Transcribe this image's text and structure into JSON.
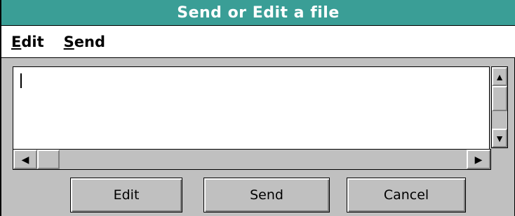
{
  "window": {
    "title": "Send or Edit a file"
  },
  "menu": {
    "items": [
      {
        "accel": "E",
        "rest": "dit"
      },
      {
        "accel": "S",
        "rest": "end"
      }
    ]
  },
  "editor": {
    "value": ""
  },
  "scrollbars": {
    "up_icon": "up-arrow-icon",
    "down_icon": "down-arrow-icon",
    "left_icon": "left-arrow-icon",
    "right_icon": "right-arrow-icon",
    "arrows": {
      "up": "▲",
      "down": "▼",
      "left": "◀",
      "right": "▶"
    }
  },
  "buttons": {
    "edit_label": "Edit",
    "send_label": "Send",
    "cancel_label": "Cancel"
  },
  "colors": {
    "titlebar": "#3a9e96",
    "face": "#c0c0c0"
  }
}
